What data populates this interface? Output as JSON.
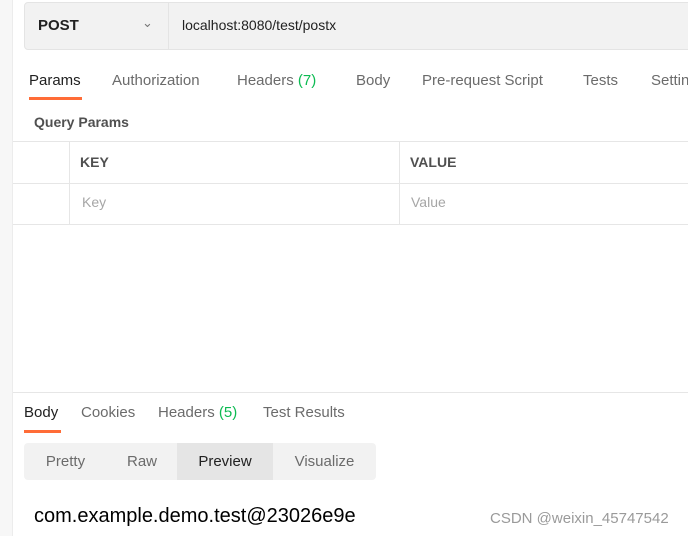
{
  "request": {
    "method": "POST",
    "url": "localhost:8080/test/postx"
  },
  "request_tabs": [
    {
      "label": "Params",
      "active": true
    },
    {
      "label": "Authorization"
    },
    {
      "label": "Headers",
      "count": "(7)"
    },
    {
      "label": "Body"
    },
    {
      "label": "Pre-request Script"
    },
    {
      "label": "Tests"
    },
    {
      "label": "Settin"
    }
  ],
  "query_params": {
    "title": "Query Params",
    "headers": [
      "KEY",
      "VALUE"
    ],
    "placeholders": [
      "Key",
      "Value"
    ]
  },
  "response_tabs": [
    {
      "label": "Body",
      "active": true
    },
    {
      "label": "Cookies"
    },
    {
      "label": "Headers",
      "count": "(5)"
    },
    {
      "label": "Test Results"
    }
  ],
  "view_modes": [
    {
      "label": "Pretty"
    },
    {
      "label": "Raw"
    },
    {
      "label": "Preview",
      "active": true
    },
    {
      "label": "Visualize"
    }
  ],
  "response_body": "com.example.demo.test@23026e9e",
  "watermark": "CSDN @weixin_45747542",
  "colors": {
    "accent": "#ff6c37",
    "count": "#0cbb52"
  }
}
